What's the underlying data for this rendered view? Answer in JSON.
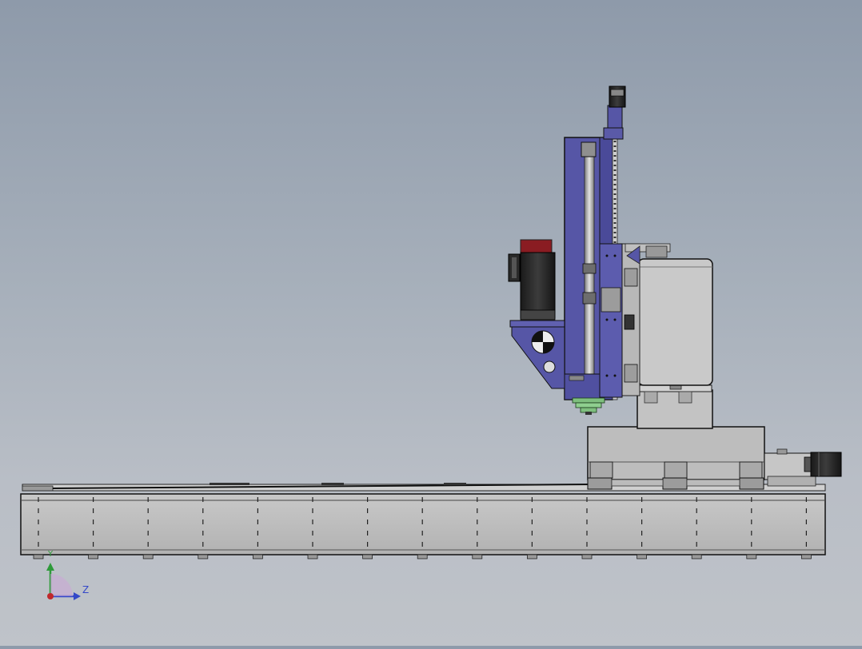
{
  "viewport": {
    "background_top": "#8e9aaa",
    "background_bottom": "#bfc3c9"
  },
  "model": {
    "column_color": "#5656a6",
    "motor_cap_color": "#8a1c22",
    "base_color": "#b9b9b9",
    "spindle_color": "#7fbf7f"
  },
  "triad": {
    "y_label": "Y",
    "z_label": "Z",
    "y_color": "#2e9a3a",
    "z_color": "#3448c8",
    "origin_color": "#c0282c"
  }
}
